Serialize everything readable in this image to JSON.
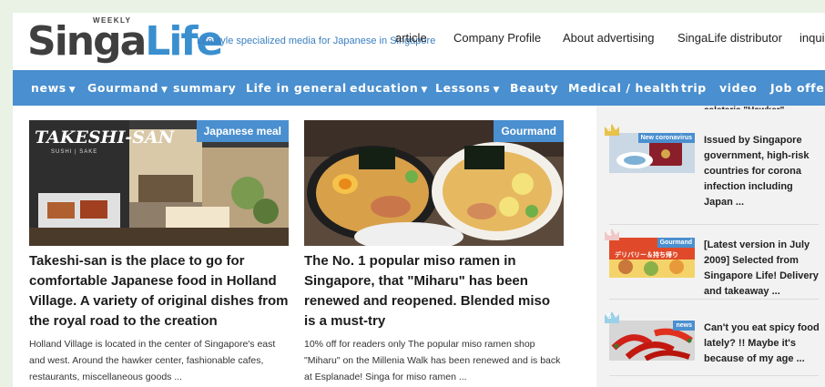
{
  "header": {
    "logo_brand_dark": "Singa",
    "logo_brand_blue": "Life",
    "logo_weekly": "WEEKLY",
    "tagline": "Lifestyle specialized media for Japanese in Singapore",
    "topnav": [
      "article",
      "Company Profile",
      "About advertising",
      "SingaLife distributor",
      "inquir"
    ]
  },
  "nav": {
    "items": [
      {
        "label": "news",
        "caret": "▼"
      },
      {
        "label": "Gourmand",
        "caret": "▼"
      },
      {
        "label": "summary",
        "caret": ""
      },
      {
        "label": "Life in general",
        "caret": ""
      },
      {
        "label": "education",
        "caret": "▼"
      },
      {
        "label": "Lessons",
        "caret": "▼"
      },
      {
        "label": "Beauty",
        "caret": ""
      },
      {
        "label": "Medical / health",
        "caret": ""
      },
      {
        "label": "trip",
        "caret": ""
      },
      {
        "label": "video",
        "caret": ""
      },
      {
        "label": "Job offer",
        "caret": ""
      }
    ]
  },
  "articles": [
    {
      "category": "Japanese meal",
      "title": "Takeshi-san is the place to go for comfortable Japanese food in Holland Village. A variety of original dishes from the royal road to the creation",
      "excerpt": "Holland Village is located in the center of Singapore's east and west. Around the hawker center, fashionable cafes, restaurants, miscellaneous goods ...",
      "sign_text": "TAKESHI-SAN",
      "sign_sub": "SUSHI | SAKE"
    },
    {
      "category": "Gourmand",
      "title": "The No. 1 popular miso ramen in Singapore, that \"Miharu\" has been renewed and reopened. Blended miso is a must-try",
      "excerpt": "10% off for readers only The popular miso ramen shop \"Miharu\" on the Millenia Walk has been renewed and is back at Esplanade! Singa for miso ramen ..."
    }
  ],
  "sidebar": {
    "partial_top": "caleteria \"Hawker\" ...",
    "ranking": [
      {
        "rank": "3",
        "category": "New coronavirus",
        "title": "Issued by Singapore government, high-risk countries for corona infection including Japan ..."
      },
      {
        "rank": "4",
        "category": "Gourmand",
        "title": "[Latest version in July 2009] Selected from Singapore Life! Delivery and takeaway ..."
      },
      {
        "rank": "5",
        "category": "news",
        "title": "Can't you eat spicy food lately? !! Maybe it's because of my age ..."
      }
    ],
    "ranking_thumb_text": "デリバリー＆持ち帰り"
  },
  "colors": {
    "accent_blue": "#4a8fcf",
    "text_dark": "#1c1c1c",
    "page_bg": "#e9f2e4",
    "sidebar_bg": "#f2f2f2"
  }
}
